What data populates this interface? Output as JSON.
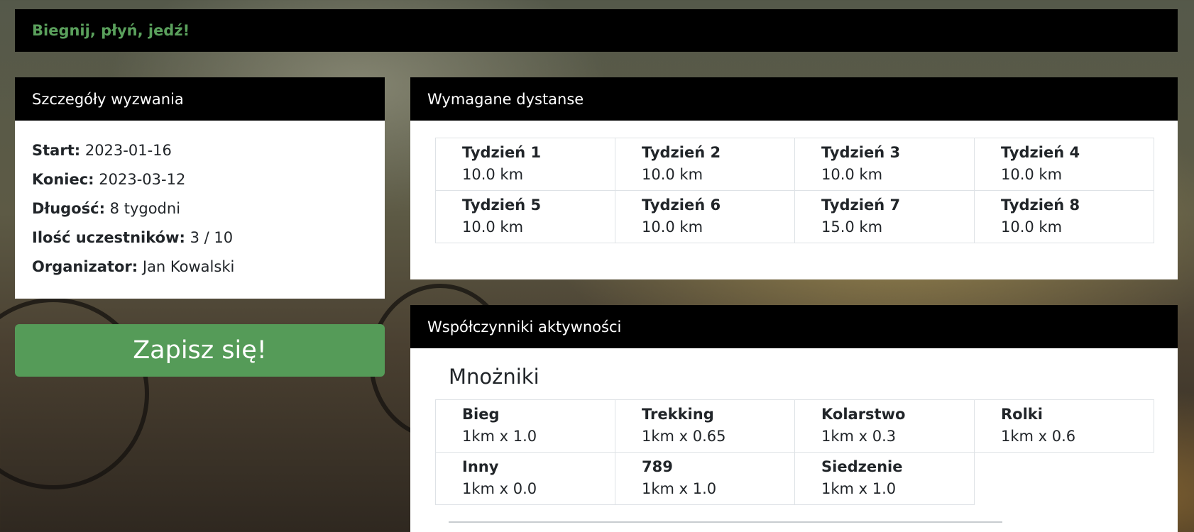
{
  "navbar": {
    "brand": "Biegnij, płyń, jedź!"
  },
  "details": {
    "header": "Szczegóły wyzwania",
    "rows": [
      {
        "label": "Start:",
        "value": "2023-01-16"
      },
      {
        "label": "Koniec:",
        "value": "2023-03-12"
      },
      {
        "label": "Długość:",
        "value": "8 tygodni"
      },
      {
        "label": "Ilość uczestników:",
        "value": "3 / 10"
      },
      {
        "label": "Organizator:",
        "value": "Jan Kowalski"
      }
    ]
  },
  "join_button": "Zapisz się!",
  "distances": {
    "header": "Wymagane dystanse",
    "weeks": [
      {
        "title": "Tydzień 1",
        "value": "10.0 km"
      },
      {
        "title": "Tydzień 2",
        "value": "10.0 km"
      },
      {
        "title": "Tydzień 3",
        "value": "10.0 km"
      },
      {
        "title": "Tydzień 4",
        "value": "10.0 km"
      },
      {
        "title": "Tydzień 5",
        "value": "10.0 km"
      },
      {
        "title": "Tydzień 6",
        "value": "10.0 km"
      },
      {
        "title": "Tydzień 7",
        "value": "15.0 km"
      },
      {
        "title": "Tydzień 8",
        "value": "10.0 km"
      }
    ]
  },
  "factors": {
    "header": "Współczynniki aktywności",
    "subtitle": "Mnożniki",
    "items": [
      {
        "title": "Bieg",
        "value": "1km x 1.0"
      },
      {
        "title": "Trekking",
        "value": "1km x 0.65"
      },
      {
        "title": "Kolarstwo",
        "value": "1km x 0.3"
      },
      {
        "title": "Rolki",
        "value": "1km x 0.6"
      },
      {
        "title": "Inny",
        "value": "1km x 0.0"
      },
      {
        "title": "789",
        "value": "1km x 1.0"
      },
      {
        "title": "Siedzenie",
        "value": "1km x 1.0"
      }
    ]
  }
}
